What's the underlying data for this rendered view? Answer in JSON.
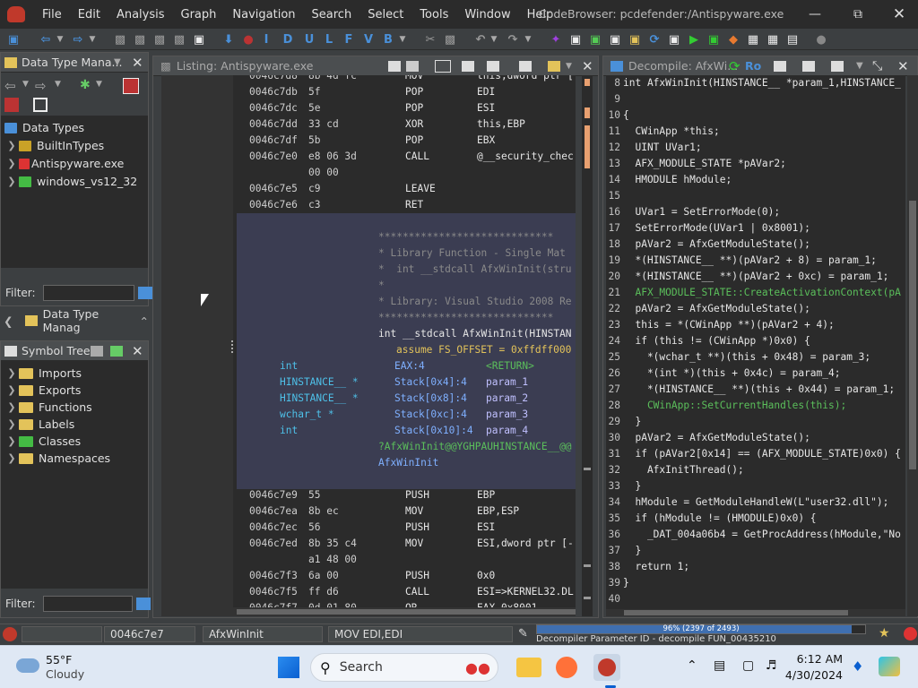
{
  "window": {
    "title": "CodeBrowser: pcdefender:/Antispyware.exe",
    "menus": [
      "File",
      "Edit",
      "Analysis",
      "Graph",
      "Navigation",
      "Search",
      "Select",
      "Tools",
      "Window",
      "Help"
    ]
  },
  "toolbar": {
    "letter_buttons": [
      "I",
      "D",
      "U",
      "L",
      "F",
      "V",
      "B"
    ]
  },
  "data_type_manager": {
    "title": "Data Type Mana...",
    "root": "Data Types",
    "items": [
      "BuiltInTypes",
      "Antispyware.exe",
      "windows_vs12_32"
    ],
    "filter_label": "Filter:",
    "collapsed_title": "Data Type Manag"
  },
  "symbol_tree": {
    "title": "Symbol Tree",
    "items": [
      "Imports",
      "Exports",
      "Functions",
      "Labels",
      "Classes",
      "Namespaces"
    ],
    "filter_label": "Filter:"
  },
  "listing": {
    "title": "Listing:  Antispyware.exe",
    "rows": [
      {
        "addr": "0046c7d8",
        "bytes": "8b 4d fc",
        "mnem": "MOV",
        "ops": "this,dword ptr ["
      },
      {
        "addr": "0046c7db",
        "bytes": "5f",
        "mnem": "POP",
        "ops": "EDI"
      },
      {
        "addr": "0046c7dc",
        "bytes": "5e",
        "mnem": "POP",
        "ops": "ESI"
      },
      {
        "addr": "0046c7dd",
        "bytes": "33 cd",
        "mnem": "XOR",
        "ops": "this,EBP"
      },
      {
        "addr": "0046c7df",
        "bytes": "5b",
        "mnem": "POP",
        "ops": "EBX"
      },
      {
        "addr": "0046c7e0",
        "bytes": "e8 06 3d",
        "mnem": "CALL",
        "ops": "@__security_chec"
      },
      {
        "addr": "",
        "bytes": "00 00",
        "mnem": "",
        "ops": ""
      },
      {
        "addr": "0046c7e5",
        "bytes": "c9",
        "mnem": "LEAVE",
        "ops": ""
      },
      {
        "addr": "0046c7e6",
        "bytes": "c3",
        "mnem": "RET",
        "ops": ""
      }
    ],
    "comments": [
      "*****************************",
      "* Library Function - Single Mat",
      "*  int __stdcall AfxWinInit(stru",
      "*",
      "* Library: Visual Studio 2008 Re",
      "*****************************"
    ],
    "signature": "int __stdcall AfxWinInit(HINSTAN",
    "assume": "assume FS_OFFSET = 0xffdff000",
    "params": [
      {
        "type": "int",
        "loc": "EAX:4",
        "name": "<RETURN>"
      },
      {
        "type": "HINSTANCE__ *",
        "loc": "Stack[0x4]:4",
        "name": "param_1"
      },
      {
        "type": "HINSTANCE__ *",
        "loc": "Stack[0x8]:4",
        "name": "param_2"
      },
      {
        "type": "wchar_t *",
        "loc": "Stack[0xc]:4",
        "name": "param_3"
      },
      {
        "type": "int",
        "loc": "Stack[0x10]:4",
        "name": "param_4"
      }
    ],
    "mangled": "?AfxWinInit@@YGHPAUHINSTANCE__@@",
    "label": "AfxWinInit",
    "rows2": [
      {
        "addr": "0046c7e7",
        "bytes": "8b ff",
        "mnem": "MOV",
        "ops": "EDI,EDI"
      },
      {
        "addr": "0046c7e9",
        "bytes": "55",
        "mnem": "PUSH",
        "ops": "EBP"
      },
      {
        "addr": "0046c7ea",
        "bytes": "8b ec",
        "mnem": "MOV",
        "ops": "EBP,ESP"
      },
      {
        "addr": "0046c7ec",
        "bytes": "56",
        "mnem": "PUSH",
        "ops": "ESI"
      },
      {
        "addr": "0046c7ed",
        "bytes": "8b 35 c4",
        "mnem": "MOV",
        "ops": "ESI,dword ptr [-"
      },
      {
        "addr": "",
        "bytes": "a1 48 00",
        "mnem": "",
        "ops": ""
      },
      {
        "addr": "0046c7f3",
        "bytes": "6a 00",
        "mnem": "PUSH",
        "ops": "0x0"
      },
      {
        "addr": "0046c7f5",
        "bytes": "ff d6",
        "mnem": "CALL",
        "ops": "ESI=>KERNEL32.DL"
      },
      {
        "addr": "0046c7f7",
        "bytes": "0d 01 80",
        "mnem": "OR",
        "ops": "EAX,0x8001"
      }
    ]
  },
  "decompiler": {
    "title": "Decompile: AfxWi...",
    "lines": [
      {
        "n": "8",
        "t": "int AfxWinInit(HINSTANCE__ *param_1,HINSTANCE_"
      },
      {
        "n": "9",
        "t": ""
      },
      {
        "n": "10",
        "t": "{"
      },
      {
        "n": "11",
        "t": "  CWinApp *this;"
      },
      {
        "n": "12",
        "t": "  UINT UVar1;"
      },
      {
        "n": "13",
        "t": "  AFX_MODULE_STATE *pAVar2;"
      },
      {
        "n": "14",
        "t": "  HMODULE hModule;"
      },
      {
        "n": "15",
        "t": ""
      },
      {
        "n": "16",
        "t": "  UVar1 = SetErrorMode(0);"
      },
      {
        "n": "17",
        "t": "  SetErrorMode(UVar1 | 0x8001);"
      },
      {
        "n": "18",
        "t": "  pAVar2 = AfxGetModuleState();"
      },
      {
        "n": "19",
        "t": "  *(HINSTANCE__ **)(pAVar2 + 8) = param_1;"
      },
      {
        "n": "20",
        "t": "  *(HINSTANCE__ **)(pAVar2 + 0xc) = param_1;"
      },
      {
        "n": "21",
        "t": "  AFX_MODULE_STATE::CreateActivationContext(pA"
      },
      {
        "n": "22",
        "t": "  pAVar2 = AfxGetModuleState();"
      },
      {
        "n": "23",
        "t": "  this = *(CWinApp **)(pAVar2 + 4);"
      },
      {
        "n": "24",
        "t": "  if (this != (CWinApp *)0x0) {"
      },
      {
        "n": "25",
        "t": "    *(wchar_t **)(this + 0x48) = param_3;"
      },
      {
        "n": "26",
        "t": "    *(int *)(this + 0x4c) = param_4;"
      },
      {
        "n": "27",
        "t": "    *(HINSTANCE__ **)(this + 0x44) = param_1;"
      },
      {
        "n": "28",
        "t": "    CWinApp::SetCurrentHandles(this);"
      },
      {
        "n": "29",
        "t": "  }"
      },
      {
        "n": "30",
        "t": "  pAVar2 = AfxGetModuleState();"
      },
      {
        "n": "31",
        "t": "  if (pAVar2[0x14] == (AFX_MODULE_STATE)0x0) {"
      },
      {
        "n": "32",
        "t": "    AfxInitThread();"
      },
      {
        "n": "33",
        "t": "  }"
      },
      {
        "n": "34",
        "t": "  hModule = GetModuleHandleW(L\"user32.dll\");"
      },
      {
        "n": "35",
        "t": "  if (hModule != (HMODULE)0x0) {"
      },
      {
        "n": "36",
        "t": "    _DAT_004a06b4 = GetProcAddress(hModule,\"No"
      },
      {
        "n": "37",
        "t": "  }"
      },
      {
        "n": "38",
        "t": "  return 1;"
      },
      {
        "n": "39",
        "t": "}"
      },
      {
        "n": "40",
        "t": ""
      }
    ]
  },
  "status": {
    "address": "0046c7e7",
    "function": "AfxWinInit",
    "instruction": "MOV EDI,EDI",
    "progress_text": "96% (2397 of 2493)",
    "progress_fraction": 0.96,
    "message": "Decompiler Parameter ID - decompile FUN_00435210"
  },
  "taskbar": {
    "temp": "55°F",
    "weather": "Cloudy",
    "search": "Search",
    "time": "6:12 AM",
    "date": "4/30/2024"
  }
}
